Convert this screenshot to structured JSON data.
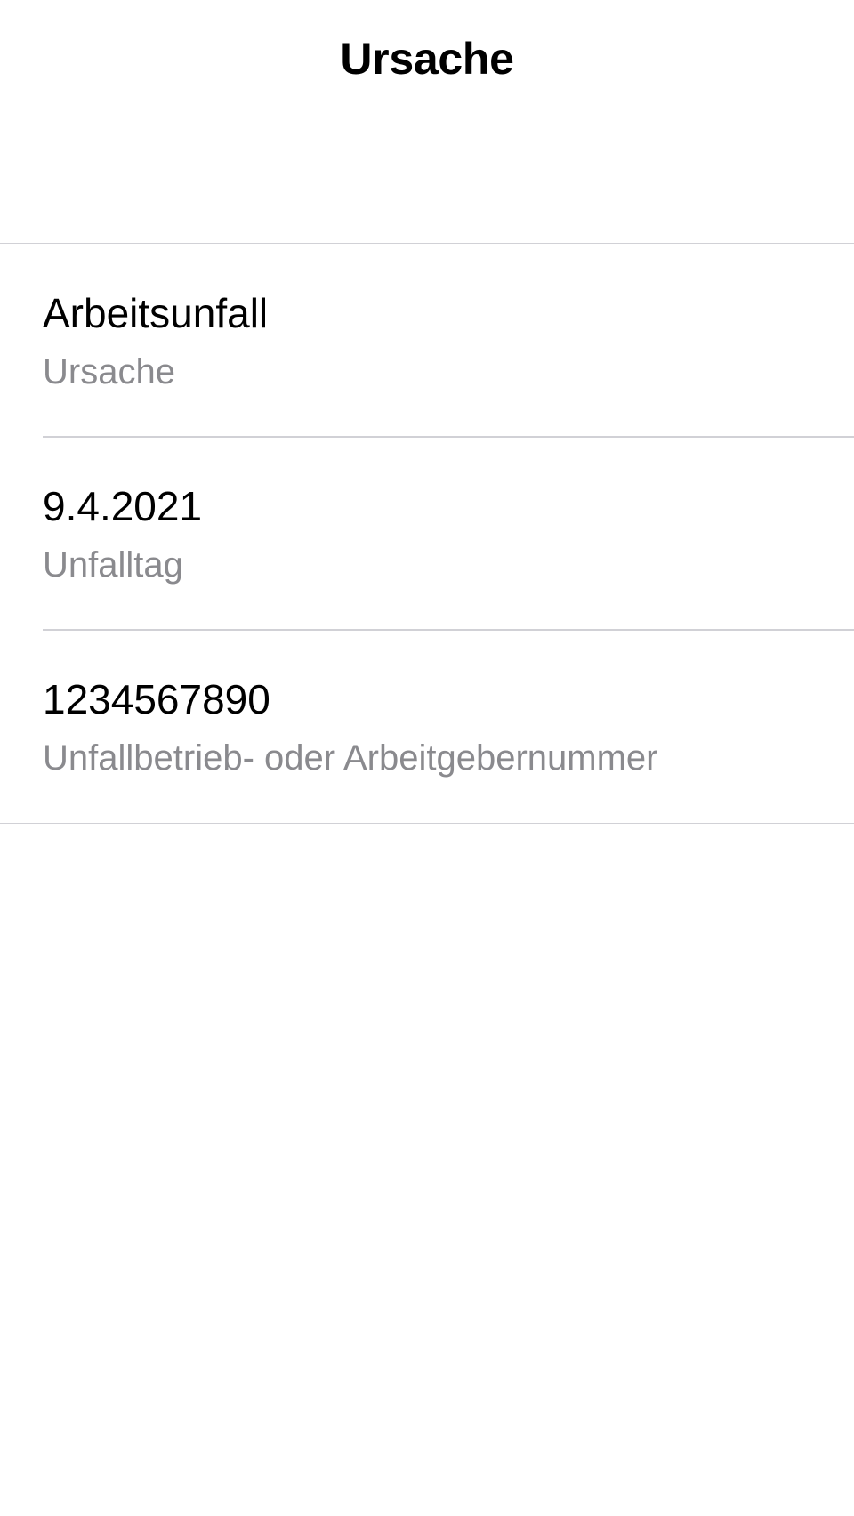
{
  "nav": {
    "title": "Ursache"
  },
  "rows": [
    {
      "value": "Arbeitsunfall",
      "label": "Ursache"
    },
    {
      "value": "9.4.2021",
      "label": "Unfalltag"
    },
    {
      "value": "1234567890",
      "label": "Unfallbetrieb- oder Arbeitgebernummer"
    }
  ],
  "colors": {
    "background": "#ffffff",
    "primary_text": "#000000",
    "secondary_text": "#8a8a8e",
    "separator": "#d1d1d6"
  }
}
